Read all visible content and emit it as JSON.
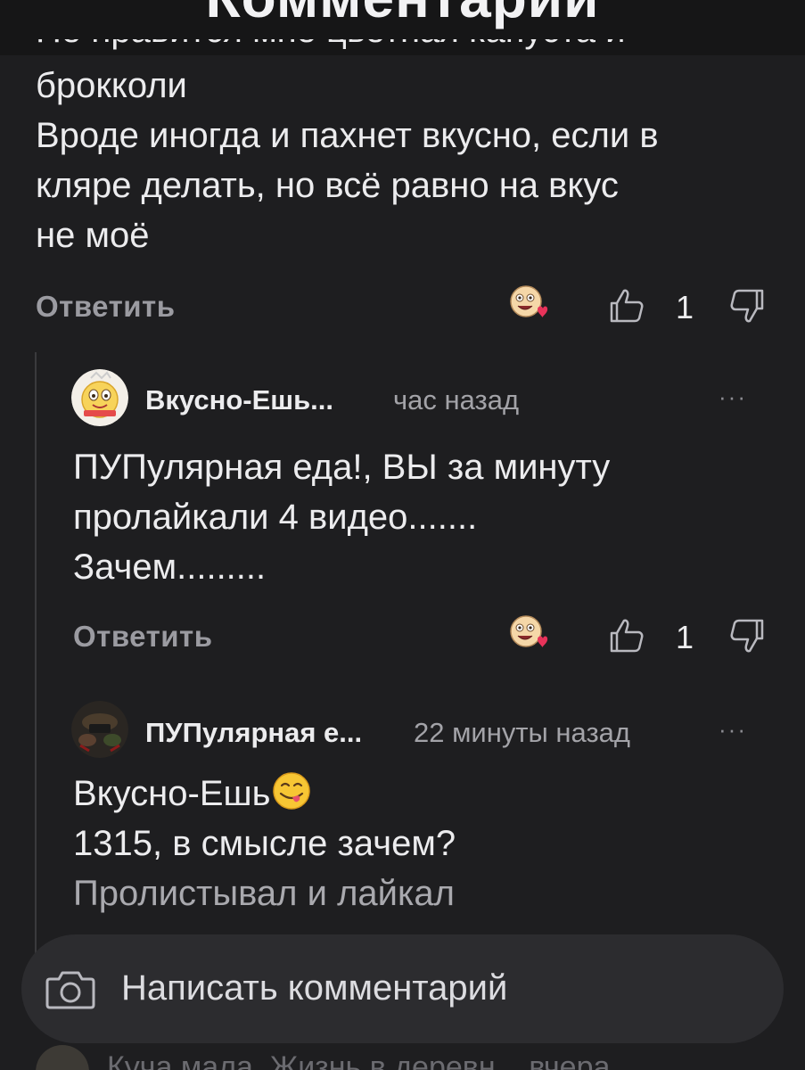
{
  "header": {
    "title": "Комментарии"
  },
  "top_comment": {
    "clipped_line": "Не нравится мне цветная капуста и",
    "lines": [
      "брокколи",
      "Вроде иногда и пахнет вкусно, если в",
      "кляре делать, но всё равно на вкус",
      "не моё"
    ],
    "reply_label": "Ответить",
    "likes": "1"
  },
  "replies": [
    {
      "author": "Вкусно-Ешь...",
      "time": "час назад",
      "lines": [
        "ПУПулярная еда!, ВЫ за минуту",
        "пролайкали 4 видео.......",
        "Зачем........."
      ],
      "reply_label": "Ответить",
      "likes": "1"
    },
    {
      "author": "ПУПулярная е...",
      "time": "22 минуты назад",
      "lines": [
        "Вкусно-Ешь",
        "1315, в смысле зачем?",
        "Пролистывал и лайкал"
      ]
    }
  ],
  "input": {
    "placeholder": "Написать комментарий"
  },
  "next_preview": {
    "text": "Куча мала. Жизнь в деревн... вчера"
  },
  "icons": {
    "reaction": "laughing-heart-emoji-icon",
    "like": "thumbs-up-icon",
    "dislike": "thumbs-down-icon",
    "more": "more-dots-icon",
    "camera": "camera-icon",
    "inline_emoji": "yum-face-emoji-icon"
  },
  "colors": {
    "background": "#1e1e20",
    "header": "#161617",
    "text": "#ececee",
    "muted": "#9b9ba1",
    "input_bg": "#2c2c2f"
  }
}
